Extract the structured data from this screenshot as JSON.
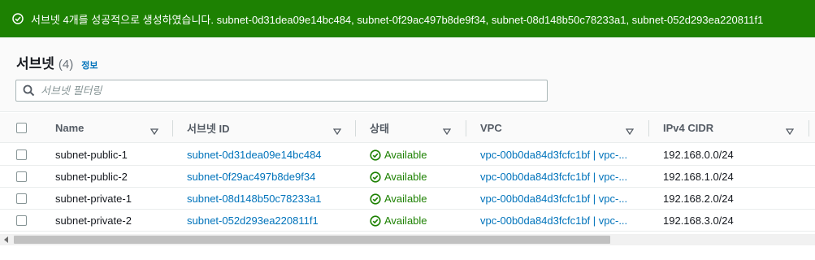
{
  "flash": {
    "message": "서브넷 4개를 성공적으로 생성하였습니다. subnet-0d31dea09e14bc484, subnet-0f29ac497b8de9f34, subnet-08d148b50c78233a1, subnet-052d293ea220811f1",
    "icon": "check-circle-icon",
    "color": "#1d8102"
  },
  "header": {
    "title": "서브넷",
    "count": "(4)",
    "info": "정보"
  },
  "search": {
    "placeholder": "서브넷 필터링",
    "value": ""
  },
  "table": {
    "columns": [
      "Name",
      "서브넷 ID",
      "상태",
      "VPC",
      "IPv4 CIDR"
    ],
    "rows": [
      {
        "name": "subnet-public-1",
        "subnet_id": "subnet-0d31dea09e14bc484",
        "status": "Available",
        "vpc": "vpc-00b0da84d3fcfc1bf | vpc-...",
        "cidr": "192.168.0.0/24"
      },
      {
        "name": "subnet-public-2",
        "subnet_id": "subnet-0f29ac497b8de9f34",
        "status": "Available",
        "vpc": "vpc-00b0da84d3fcfc1bf | vpc-...",
        "cidr": "192.168.1.0/24"
      },
      {
        "name": "subnet-private-1",
        "subnet_id": "subnet-08d148b50c78233a1",
        "status": "Available",
        "vpc": "vpc-00b0da84d3fcfc1bf | vpc-...",
        "cidr": "192.168.2.0/24"
      },
      {
        "name": "subnet-private-2",
        "subnet_id": "subnet-052d293ea220811f1",
        "status": "Available",
        "vpc": "vpc-00b0da84d3fcfc1bf | vpc-...",
        "cidr": "192.168.3.0/24"
      }
    ]
  },
  "colors": {
    "success": "#1d8102",
    "link": "#0073bb",
    "header_text": "#545b64"
  }
}
